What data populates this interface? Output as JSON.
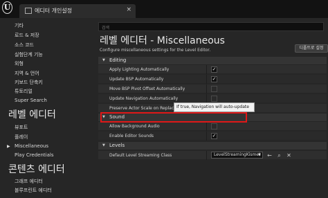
{
  "window": {
    "tab_title": "에디터 개인설정",
    "close": "×"
  },
  "sidebar": {
    "items_top": [
      "기타",
      "로드 & 저장",
      "소스 코드",
      "실험단계 기능",
      "외형",
      "지역 & 언어",
      "키보드 단축키",
      "튜토리얼",
      "Super Search"
    ],
    "header_level": "레벨 에디터",
    "items_level": [
      "뷰포트",
      "플레이",
      "Miscellaneous",
      "Play Credentials"
    ],
    "header_content": "콘텐츠 에디터",
    "items_content": [
      "그래프 에디터",
      "블루프린트 에디터"
    ],
    "selected_marker": "▶"
  },
  "content": {
    "search_placeholder": "검색",
    "title": "레벨 에디터 - Miscellaneous",
    "description": "Configure miscellaneous settings for the Level Editor.",
    "default_button": "디폴트로 설정",
    "categories": {
      "editing": "Editing",
      "sound": "Sound",
      "levels": "Levels"
    },
    "editing_rows": [
      {
        "label": "Apply Lighting Automatically",
        "checked": true
      },
      {
        "label": "Update BSP Automatically",
        "checked": true
      },
      {
        "label": "Move BSP Pivot Offset Automatically",
        "checked": false
      },
      {
        "label": "Update Navigation Automatically",
        "checked": false
      },
      {
        "label": "Preserve Actor Scale on Replace",
        "checked": false
      }
    ],
    "sound_rows": [
      {
        "label": "Allow Background Audio",
        "checked": false
      },
      {
        "label": "Enable Editor Sounds",
        "checked": true
      }
    ],
    "levels_rows": [
      {
        "label": "Default Level Streaming Class",
        "value": "LevelStreamingKismet"
      }
    ],
    "tooltip": "If true, Navigation will auto-update",
    "check_glyph": "✓",
    "collapse_glyph": "▼",
    "dropdown_arrow": "▼",
    "icons": [
      "arrow-right-icon",
      "search-icon",
      "clear-icon"
    ],
    "icon_glyphs": [
      "←",
      "⌕",
      "✕"
    ],
    "highlight_color": "#e01818"
  }
}
